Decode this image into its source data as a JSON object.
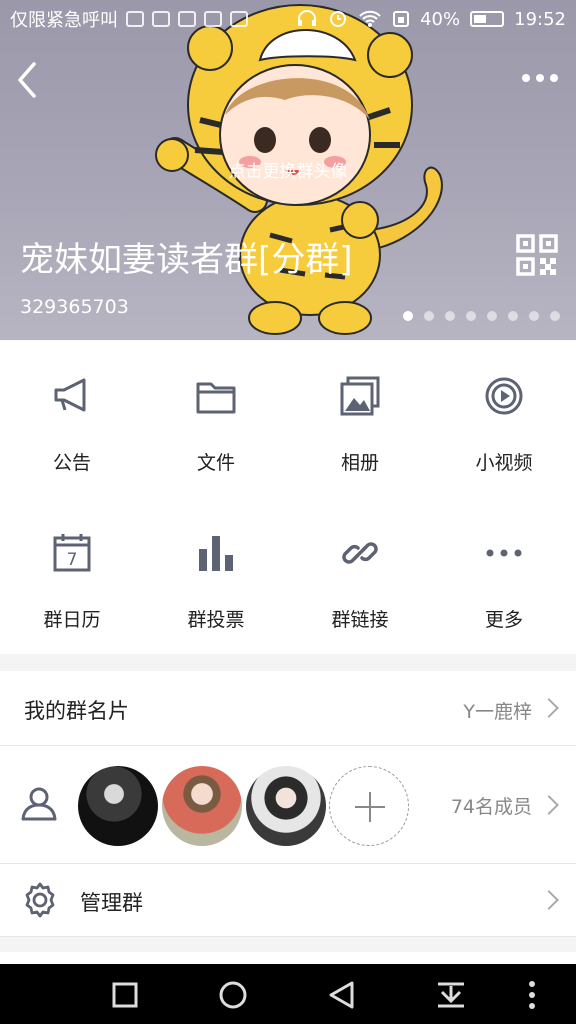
{
  "status_bar": {
    "carrier": "仅限紧急呼叫",
    "battery": "40%",
    "time": "19:52"
  },
  "header": {
    "avatar_hint": "点击更换群头像",
    "group_name": "宠妹如妻读者群[分群]",
    "group_id": "329365703",
    "page_indicator": {
      "count": 8,
      "active": 0
    }
  },
  "features": [
    {
      "label": "公告",
      "icon": "megaphone-icon"
    },
    {
      "label": "文件",
      "icon": "folder-icon"
    },
    {
      "label": "相册",
      "icon": "album-icon"
    },
    {
      "label": "小视频",
      "icon": "video-icon"
    },
    {
      "label": "群日历",
      "icon": "calendar-icon"
    },
    {
      "label": "群投票",
      "icon": "bar-chart-icon"
    },
    {
      "label": "群链接",
      "icon": "link-icon"
    },
    {
      "label": "更多",
      "icon": "ellipsis-icon"
    }
  ],
  "calendar_day": "7",
  "card": {
    "label": "我的群名片",
    "value": "Y一鹿梓"
  },
  "members": {
    "count_label": "74名成员"
  },
  "manage": {
    "label": "管理群"
  },
  "colors": {
    "icon": "#5d6373",
    "hero": "#a19fb0",
    "nav": "#000000"
  }
}
